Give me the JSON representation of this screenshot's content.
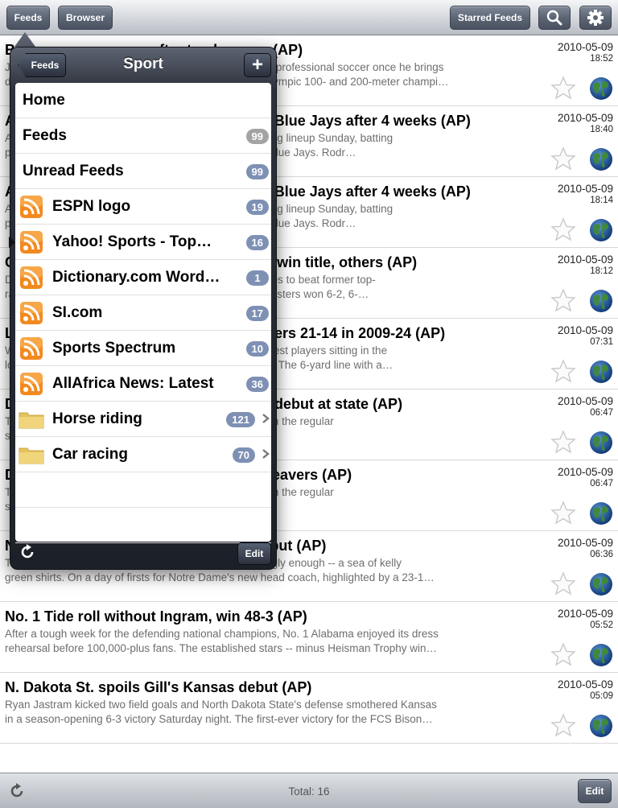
{
  "toolbar": {
    "feeds_label": "Feeds",
    "browser_label": "Browser",
    "starred_label": "Starred Feeds",
    "search_icon": "search-icon",
    "settings_icon": "gear-icon"
  },
  "articles": [
    {
      "title": "Bolt eyes pro soccer after track career (AP)",
      "desc_1": "Jamaican sprinter Usain Bolt says he would love to play professional soccer once he brings",
      "desc_2": "down the curtain on his record-breaking career as an Olympic 100- and 200-meter champi…",
      "date": "2010-05-09",
      "time": "18:52"
    },
    {
      "title": "A-Rod sits out again as Yankees fall to Blue Jays after 4 weeks (AP)",
      "desc_1": "Alex Rodriguez was out of the New York Yankees' starting lineup Sunday, batting",
      "desc_2": "practice only a day after a 3-1 loss against the Toronto Blue Jays. Rodr…",
      "date": "2010-05-09",
      "time": "18:40"
    },
    {
      "title": "A-Rod sits out again as Yankees fall to Blue Jays after 4 weeks (AP)",
      "desc_1": "Alex Rodriguez was out of the New York Yankees' starting lineup Sunday, batting",
      "desc_2": "practice only a day after a 3-1 loss against the Toronto Blue Jays. Rodr…",
      "date": "2010-05-09",
      "time": "18:14"
    },
    {
      "title": "Clijsters beats Henin in straight sets to win title, others (AP)",
      "desc_1": "Defending champion Kim Clijsters needed just 59 minutes to beat former top-",
      "desc_2": "ranked Justine Henin Sunday, as the second-seeded Clijsters won 6-2, 6-…",
      "date": "2010-05-09",
      "time": "18:12"
    },
    {
      "title": "Late touchdown lifts Chiefs over Chargers 21-14 in 2009-24 (AP)",
      "desc_1": "With San Diego's offense stalling, and with a few of its best players sitting in the",
      "desc_2": "locker room, the Chiefs got the ball in favorable position. The 6-yard line with a…",
      "date": "2010-05-09",
      "time": "07:31"
    },
    {
      "title": "Dalton leads TCU past Oregon State in debut at state (AP)",
      "desc_1": "The TCU Horned Frogs were trying to be perfect again in the regular",
      "desc_2": "season. The sixth-ranked Horned Frogs didn't slip up…",
      "date": "2010-05-09",
      "time": "06:47"
    },
    {
      "title": "Dalton leads TCU past Oregon State, Beavers (AP)",
      "desc_1": "The TCU Horned Frogs were trying to be perfect again in the regular",
      "desc_2": "season. The sixth-ranked Horned Frogs didn't slip up…",
      "date": "2010-05-09",
      "time": "06:47"
    },
    {
      "title": "Notre Dame beats Purdue in Kelly's debut (AP)",
      "desc_1": "The Fighting Irish looked out over a sea of green -- fittingly enough -- a sea of kelly",
      "desc_2": "green shirts. On a day of firsts for Notre Dame's new head coach, highlighted by a 23-1…",
      "date": "2010-05-09",
      "time": "06:36"
    },
    {
      "title": "No. 1 Tide roll without Ingram, win 48-3 (AP)",
      "desc_1": "After a tough week for the defending national champions, No. 1 Alabama enjoyed its dress",
      "desc_2": "rehearsal before 100,000-plus fans. The established stars -- minus Heisman Trophy win…",
      "date": "2010-05-09",
      "time": "05:52"
    },
    {
      "title": "N. Dakota St. spoils Gill's Kansas debut (AP)",
      "desc_1": "Ryan Jastram kicked two field goals and North Dakota State's defense smothered Kansas",
      "desc_2": "in a season-opening 6-3 victory Saturday night. The first-ever victory for the FCS Bison…",
      "date": "2010-05-09",
      "time": "05:09"
    }
  ],
  "popover": {
    "title": "Sport",
    "back_label": "Feeds",
    "plus_label": "+",
    "edit_label": "Edit",
    "rows": [
      {
        "label": "Home",
        "badge": "",
        "icon": "none",
        "chevron": false,
        "selected": false
      },
      {
        "label": "Feeds",
        "badge": "99",
        "icon": "none",
        "chevron": false,
        "selected": false,
        "badge_color": "#a3a3a3"
      },
      {
        "label": "Unread Feeds",
        "badge": "99",
        "icon": "none",
        "chevron": false,
        "selected": false,
        "badge_color": "#7e90b4"
      },
      {
        "label": "ESPN logo",
        "badge": "19",
        "icon": "rss-icon",
        "chevron": false,
        "selected": false,
        "badge_color": "#7e90b4"
      },
      {
        "label": "Yahoo! Sports - Top…",
        "badge": "16",
        "icon": "rss-icon",
        "chevron": false,
        "selected": true,
        "badge_color": "#7e90b4"
      },
      {
        "label": "Dictionary.com Word…",
        "badge": "1",
        "icon": "rss-icon",
        "chevron": false,
        "selected": false,
        "badge_color": "#7e90b4"
      },
      {
        "label": "SI.com",
        "badge": "17",
        "icon": "rss-icon",
        "chevron": false,
        "selected": false,
        "badge_color": "#7e90b4"
      },
      {
        "label": "Sports Spectrum",
        "badge": "10",
        "icon": "rss-icon",
        "chevron": false,
        "selected": false,
        "badge_color": "#7e90b4"
      },
      {
        "label": "AllAfrica News: Latest",
        "badge": "36",
        "icon": "rss-icon",
        "chevron": false,
        "selected": false,
        "badge_color": "#7e90b4"
      },
      {
        "label": "Horse riding",
        "badge": "121",
        "icon": "folder-icon",
        "chevron": true,
        "selected": false,
        "badge_color": "#7e90b4"
      },
      {
        "label": "Car racing",
        "badge": "70",
        "icon": "folder-icon",
        "chevron": true,
        "selected": false,
        "badge_color": "#7e90b4"
      }
    ]
  },
  "bottom": {
    "total_label": "Total: 16",
    "edit_label": "Edit"
  }
}
